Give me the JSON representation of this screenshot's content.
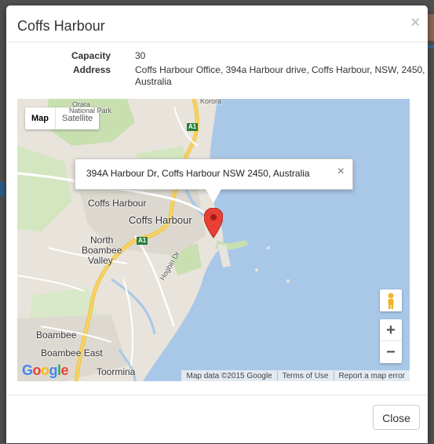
{
  "modal": {
    "title": "Coffs Harbour",
    "close_glyph": "×"
  },
  "details": {
    "capacity_label": "Capacity",
    "capacity_value": "30",
    "address_label": "Address",
    "address_value": "Coffs Harbour Office, 394a Harbour drive, Coffs Harbour, NSW, 2450, Australia"
  },
  "map": {
    "type_map_label": "Map",
    "type_satellite_label": "Satellite",
    "info_window_text": "394A Harbour Dr, Coffs Harbour NSW 2450, Australia",
    "info_window_close": "×",
    "zoom_in_label": "+",
    "zoom_out_label": "−",
    "attribution": [
      "Map data ©2015 Google",
      "Terms of Use",
      "Report a map error"
    ],
    "logo_text": "Google",
    "places": {
      "national_park": "National Park",
      "orara": "Orara",
      "coffs_harbour": "Coffs Harbour",
      "coffs_harbour_city": "Coffs Harbour",
      "north_boambee": "North",
      "north_boambee2": "Boambee",
      "north_boambee3": "Valley",
      "boambee": "Boambee",
      "boambee_east": "Boambee East",
      "toormina": "Toormina",
      "hogbin_dr": "Hogbin Dr",
      "korora": "Korora",
      "road_a1": "A1"
    },
    "colors": {
      "water": "#a9c8e8",
      "land": "#e8e4dc",
      "park": "#c8dfb0",
      "highway": "#f7d266",
      "marker": "#e84035"
    }
  },
  "footer": {
    "close_button": "Close"
  }
}
